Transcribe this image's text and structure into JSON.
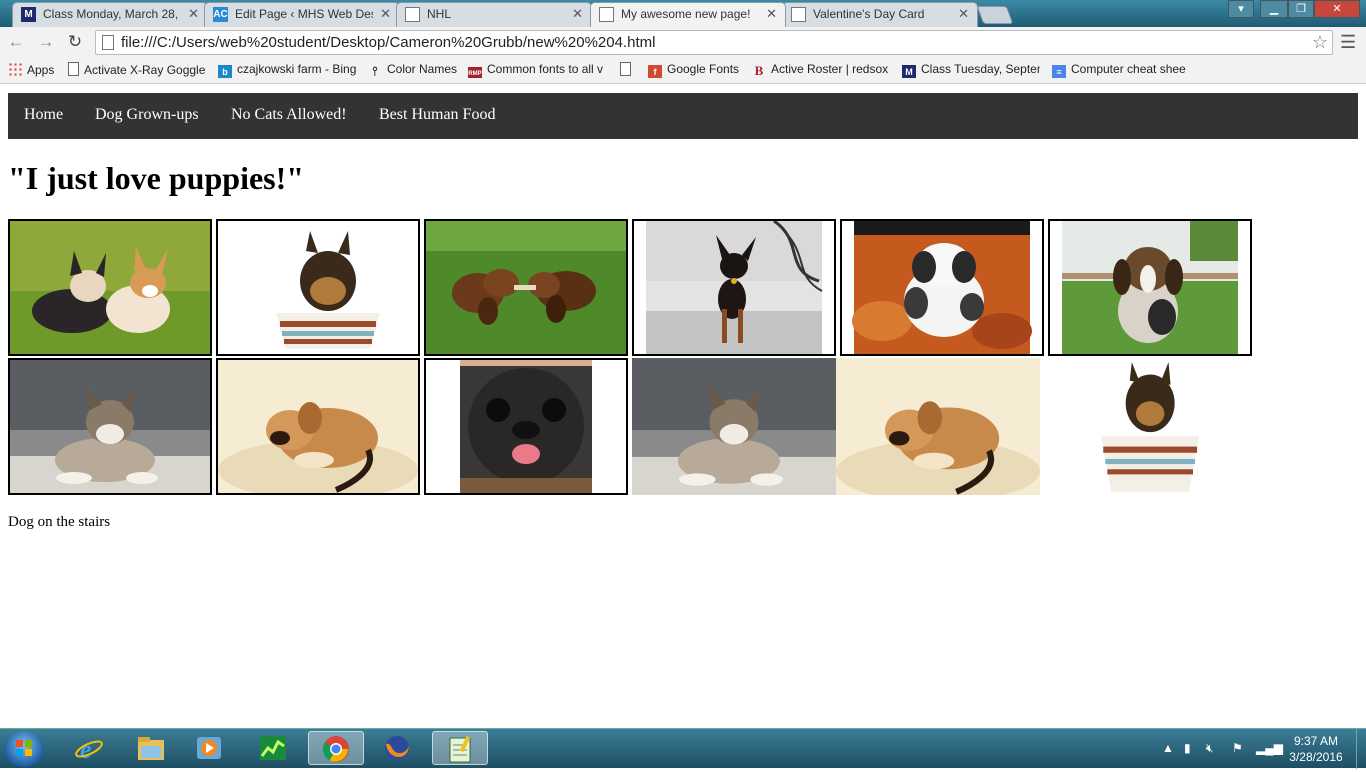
{
  "browser": {
    "tabs": [
      {
        "title": "Class Monday, March 28,",
        "icon": "m-icon"
      },
      {
        "title": "Edit Page ‹ MHS Web Des",
        "icon": "ac-icon"
      },
      {
        "title": "NHL",
        "icon": "page-icon"
      },
      {
        "title": "My awesome new page!",
        "icon": "page-icon",
        "active": true
      },
      {
        "title": "Valentine's Day Card",
        "icon": "page-icon"
      }
    ],
    "url": "file:///C:/Users/web%20student/Desktop/Cameron%20Grubb/new%20%204.html",
    "bookmarks": [
      {
        "label": "Apps",
        "icon": "apps-icon"
      },
      {
        "label": "Activate X-Ray Goggle",
        "icon": "page-icon"
      },
      {
        "label": "czajkowski farm - Bing",
        "icon": "bing-icon"
      },
      {
        "label": "Color Names",
        "icon": "pin-icon"
      },
      {
        "label": "Common fonts to all v",
        "icon": "rmp-icon"
      },
      {
        "label": "",
        "icon": "page-icon"
      },
      {
        "label": "Google Fonts",
        "icon": "google-fonts-icon"
      },
      {
        "label": "Active Roster | redsox",
        "icon": "b-icon"
      },
      {
        "label": "Class Tuesday, Septen",
        "icon": "m-icon"
      },
      {
        "label": "Computer cheat shee",
        "icon": "docs-icon"
      }
    ]
  },
  "site": {
    "nav": [
      "Home",
      "Dog Grown-ups",
      "No Cats Allowed!",
      "Best Human Food"
    ],
    "headline": "\"I just love puppies!\"",
    "caption": "Dog on the stairs",
    "photos": [
      {
        "name": "corgi-puppies-photo",
        "bordered": true
      },
      {
        "name": "yorkie-in-cup-photo",
        "bordered": true
      },
      {
        "name": "dachshund-puppies-photo",
        "bordered": true
      },
      {
        "name": "dog-on-stairs-photo",
        "bordered": true
      },
      {
        "name": "saint-bernard-leaves-photo",
        "bordered": true
      },
      {
        "name": "beagle-puppy-photo",
        "bordered": true
      },
      {
        "name": "husky-mix-puppy-photo",
        "bordered": true
      },
      {
        "name": "sleepy-puppy-sand-photo",
        "bordered": true
      },
      {
        "name": "pug-tongue-photo",
        "bordered": true
      },
      {
        "name": "husky-mix-puppy-photo-2",
        "bordered": false
      },
      {
        "name": "sleepy-puppy-sand-photo-2",
        "bordered": false
      },
      {
        "name": "yorkie-in-cup-photo-2",
        "bordered": false
      }
    ]
  },
  "taskbar": {
    "apps": [
      "internet-explorer-icon",
      "file-explorer-icon",
      "media-player-icon",
      "task-manager-icon",
      "chrome-icon",
      "firefox-icon",
      "notepad-icon"
    ],
    "active_app": "chrome-icon",
    "time": "9:37 AM",
    "date": "3/28/2016"
  },
  "colors": {
    "site_nav_bg": "#333333",
    "tab_strip": "#2d6f8a"
  }
}
